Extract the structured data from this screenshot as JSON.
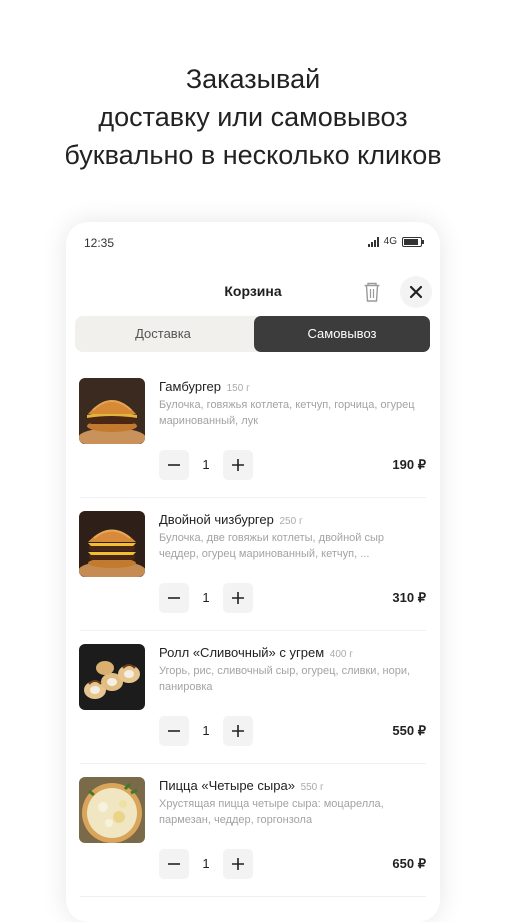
{
  "headline": {
    "line1": "Заказывай",
    "line2": "доставку или самовывоз",
    "line3": "буквально в несколько кликов"
  },
  "status_bar": {
    "time": "12:35",
    "network": "4G"
  },
  "cart": {
    "title": "Корзина",
    "tabs": [
      {
        "label": "Доставка",
        "selected": false
      },
      {
        "label": "Самовывоз",
        "selected": true
      }
    ],
    "items": [
      {
        "name": "Гамбургер",
        "weight": "150 г",
        "description": "Булочка, говяжья котлета, кетчуп, горчица, огурец маринованный, лук",
        "quantity": "1",
        "price": "190 ₽"
      },
      {
        "name": "Двойной чизбургер",
        "weight": "250 г",
        "description": "Булочка, две говяжьи котлеты, двойной сыр чеддер, огурец маринованный, кетчуп, ...",
        "quantity": "1",
        "price": "310 ₽"
      },
      {
        "name": "Ролл «Сливочный» с угрем",
        "weight": "400 г",
        "description": "Угорь, рис, сливочный сыр, огурец, сливки, нори, панировка",
        "quantity": "1",
        "price": "550 ₽"
      },
      {
        "name": "Пицца «Четыре сыра»",
        "weight": "550 г",
        "description": "Хрустящая пицца четыре сыра: моцарелла, пармезан, чеддер, горгонзола",
        "quantity": "1",
        "price": "650 ₽"
      }
    ]
  },
  "colors": {
    "active_tab": "#3c3c3c",
    "tabs_background": "#f2f0ed",
    "muted_text": "#a3a3a3"
  }
}
